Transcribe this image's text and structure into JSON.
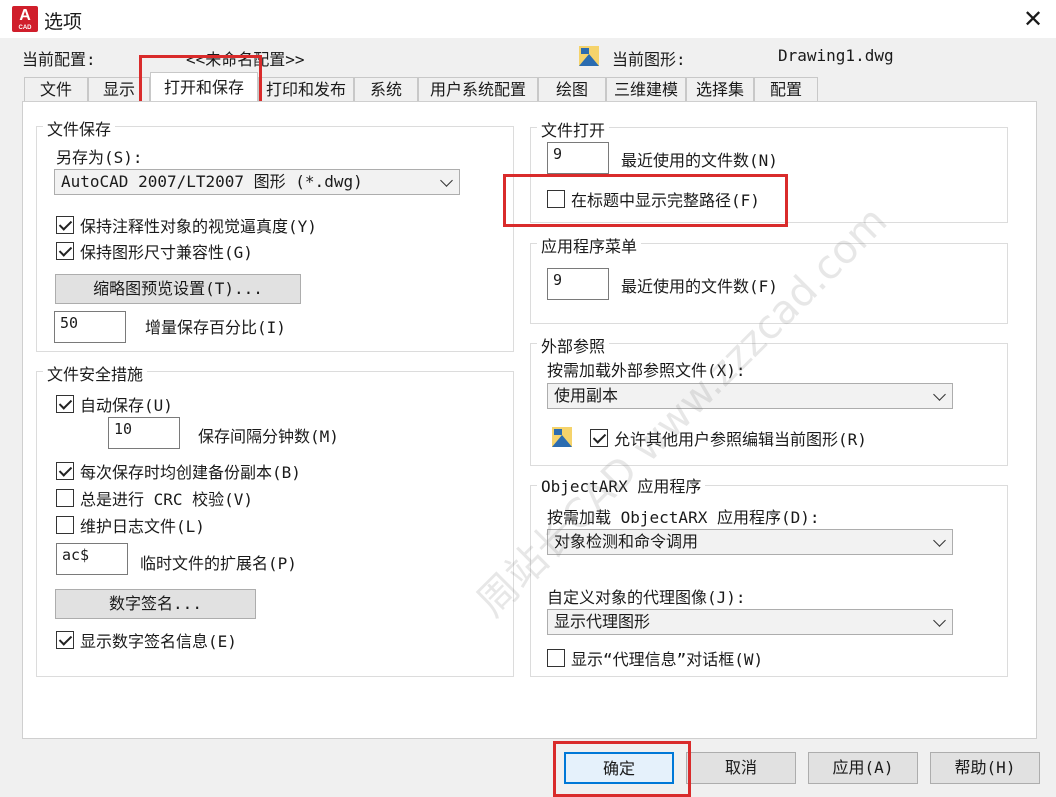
{
  "window": {
    "title": "选项",
    "logo_letter": "A",
    "logo_sub": "CAD"
  },
  "header": {
    "profile_label": "当前配置:",
    "profile_value": "<<未命名配置>>",
    "drawing_label": "当前图形:",
    "drawing_value": "Drawing1.dwg"
  },
  "tabs": [
    "文件",
    "显示",
    "打开和保存",
    "打印和发布",
    "系统",
    "用户系统配置",
    "绘图",
    "三维建模",
    "选择集",
    "配置"
  ],
  "active_tab": "打开和保存",
  "file_save": {
    "legend": "文件保存",
    "saveas_label": "另存为(S):",
    "saveas_value": "AutoCAD 2007/LT2007 图形 (*.dwg)",
    "maintain_visual_fidelity": {
      "label": "保持注释性对象的视觉逼真度(Y)",
      "checked": true
    },
    "maintain_drawing_size": {
      "label": "保持图形尺寸兼容性(G)",
      "checked": true
    },
    "thumbnail_button": "缩略图预览设置(T)...",
    "incremental_value": "50",
    "incremental_label": "增量保存百分比(I)"
  },
  "file_safety": {
    "legend": "文件安全措施",
    "autosave": {
      "label": "自动保存(U)",
      "checked": true
    },
    "minutes_value": "10",
    "minutes_label": "保存间隔分钟数(M)",
    "backup": {
      "label": "每次保存时均创建备份副本(B)",
      "checked": true
    },
    "crc": {
      "label": "总是进行 CRC 校验(V)",
      "checked": false
    },
    "log": {
      "label": "维护日志文件(L)",
      "checked": false
    },
    "temp_ext_value": "ac$",
    "temp_ext_label": "临时文件的扩展名(P)",
    "digital_sig_button": "数字签名...",
    "show_sig": {
      "label": "显示数字签名信息(E)",
      "checked": true
    }
  },
  "file_open": {
    "legend": "文件打开",
    "recent_value": "9",
    "recent_label": "最近使用的文件数(N)",
    "full_path": {
      "label": "在标题中显示完整路径(F)",
      "checked": false
    }
  },
  "app_menu": {
    "legend": "应用程序菜单",
    "recent_value": "9",
    "recent_label": "最近使用的文件数(F)"
  },
  "xref": {
    "legend": "外部参照",
    "demand_label": "按需加载外部参照文件(X):",
    "demand_value": "使用副本",
    "allow_edit": {
      "label": "允许其他用户参照编辑当前图形(R)",
      "checked": true
    }
  },
  "objectarx": {
    "legend": "ObjectARX 应用程序",
    "demand_label": "按需加载 ObjectARX 应用程序(D):",
    "demand_value": "对象检测和命令调用",
    "proxy_label": "自定义对象的代理图像(J):",
    "proxy_value": "显示代理图形",
    "proxy_dialog": {
      "label": "显示“代理信息”对话框(W)",
      "checked": false
    }
  },
  "buttons": {
    "ok": "确定",
    "cancel": "取消",
    "apply": "应用(A)",
    "help": "帮助(H)"
  },
  "watermark": "周站长CAD www.zzzcad.com",
  "colors": {
    "highlight": "#d92b2b",
    "logo": "#d01e2b",
    "default_button_border": "#0078d7"
  }
}
